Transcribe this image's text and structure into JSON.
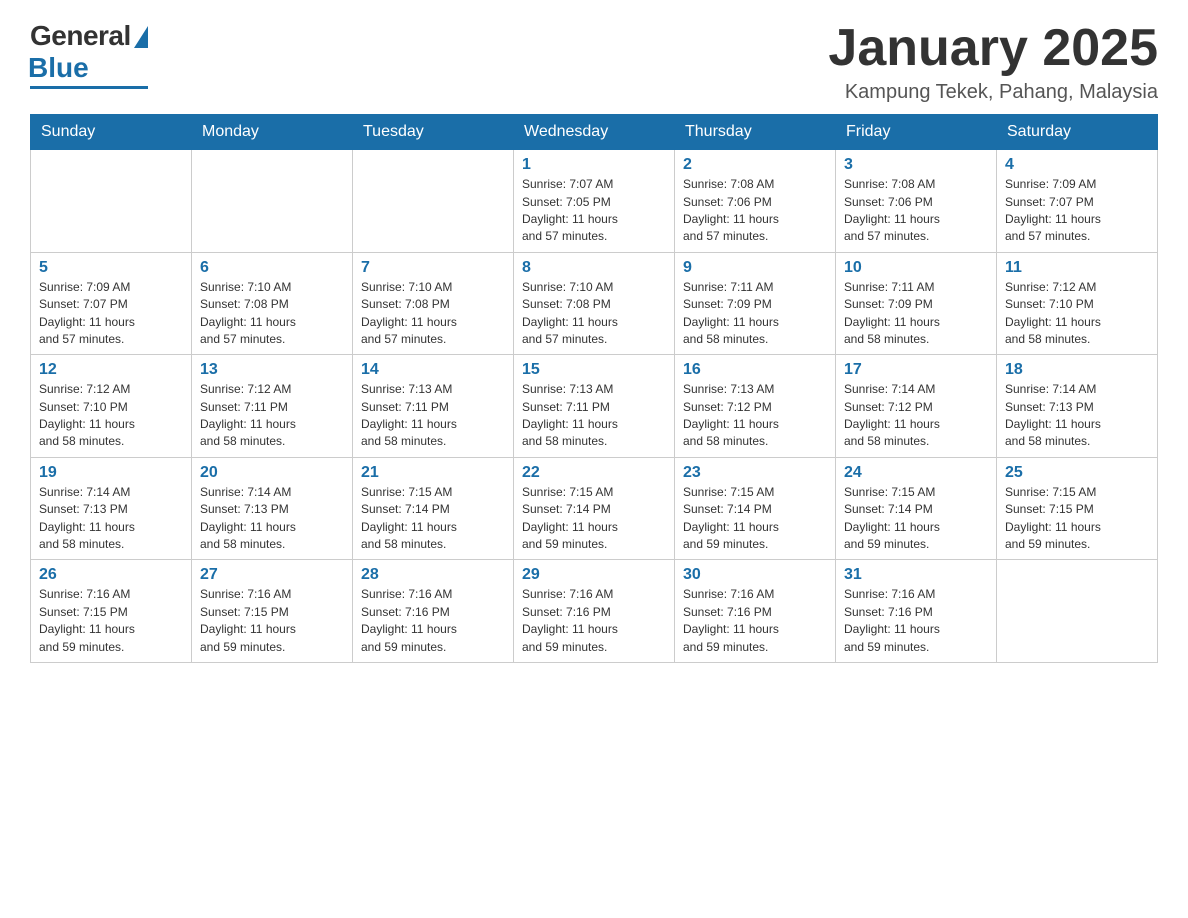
{
  "header": {
    "logo": {
      "general_text": "General",
      "blue_text": "Blue"
    },
    "title": "January 2025",
    "subtitle": "Kampung Tekek, Pahang, Malaysia"
  },
  "days_of_week": [
    "Sunday",
    "Monday",
    "Tuesday",
    "Wednesday",
    "Thursday",
    "Friday",
    "Saturday"
  ],
  "weeks": [
    [
      {
        "day": "",
        "info": ""
      },
      {
        "day": "",
        "info": ""
      },
      {
        "day": "",
        "info": ""
      },
      {
        "day": "1",
        "info": "Sunrise: 7:07 AM\nSunset: 7:05 PM\nDaylight: 11 hours\nand 57 minutes."
      },
      {
        "day": "2",
        "info": "Sunrise: 7:08 AM\nSunset: 7:06 PM\nDaylight: 11 hours\nand 57 minutes."
      },
      {
        "day": "3",
        "info": "Sunrise: 7:08 AM\nSunset: 7:06 PM\nDaylight: 11 hours\nand 57 minutes."
      },
      {
        "day": "4",
        "info": "Sunrise: 7:09 AM\nSunset: 7:07 PM\nDaylight: 11 hours\nand 57 minutes."
      }
    ],
    [
      {
        "day": "5",
        "info": "Sunrise: 7:09 AM\nSunset: 7:07 PM\nDaylight: 11 hours\nand 57 minutes."
      },
      {
        "day": "6",
        "info": "Sunrise: 7:10 AM\nSunset: 7:08 PM\nDaylight: 11 hours\nand 57 minutes."
      },
      {
        "day": "7",
        "info": "Sunrise: 7:10 AM\nSunset: 7:08 PM\nDaylight: 11 hours\nand 57 minutes."
      },
      {
        "day": "8",
        "info": "Sunrise: 7:10 AM\nSunset: 7:08 PM\nDaylight: 11 hours\nand 57 minutes."
      },
      {
        "day": "9",
        "info": "Sunrise: 7:11 AM\nSunset: 7:09 PM\nDaylight: 11 hours\nand 58 minutes."
      },
      {
        "day": "10",
        "info": "Sunrise: 7:11 AM\nSunset: 7:09 PM\nDaylight: 11 hours\nand 58 minutes."
      },
      {
        "day": "11",
        "info": "Sunrise: 7:12 AM\nSunset: 7:10 PM\nDaylight: 11 hours\nand 58 minutes."
      }
    ],
    [
      {
        "day": "12",
        "info": "Sunrise: 7:12 AM\nSunset: 7:10 PM\nDaylight: 11 hours\nand 58 minutes."
      },
      {
        "day": "13",
        "info": "Sunrise: 7:12 AM\nSunset: 7:11 PM\nDaylight: 11 hours\nand 58 minutes."
      },
      {
        "day": "14",
        "info": "Sunrise: 7:13 AM\nSunset: 7:11 PM\nDaylight: 11 hours\nand 58 minutes."
      },
      {
        "day": "15",
        "info": "Sunrise: 7:13 AM\nSunset: 7:11 PM\nDaylight: 11 hours\nand 58 minutes."
      },
      {
        "day": "16",
        "info": "Sunrise: 7:13 AM\nSunset: 7:12 PM\nDaylight: 11 hours\nand 58 minutes."
      },
      {
        "day": "17",
        "info": "Sunrise: 7:14 AM\nSunset: 7:12 PM\nDaylight: 11 hours\nand 58 minutes."
      },
      {
        "day": "18",
        "info": "Sunrise: 7:14 AM\nSunset: 7:13 PM\nDaylight: 11 hours\nand 58 minutes."
      }
    ],
    [
      {
        "day": "19",
        "info": "Sunrise: 7:14 AM\nSunset: 7:13 PM\nDaylight: 11 hours\nand 58 minutes."
      },
      {
        "day": "20",
        "info": "Sunrise: 7:14 AM\nSunset: 7:13 PM\nDaylight: 11 hours\nand 58 minutes."
      },
      {
        "day": "21",
        "info": "Sunrise: 7:15 AM\nSunset: 7:14 PM\nDaylight: 11 hours\nand 58 minutes."
      },
      {
        "day": "22",
        "info": "Sunrise: 7:15 AM\nSunset: 7:14 PM\nDaylight: 11 hours\nand 59 minutes."
      },
      {
        "day": "23",
        "info": "Sunrise: 7:15 AM\nSunset: 7:14 PM\nDaylight: 11 hours\nand 59 minutes."
      },
      {
        "day": "24",
        "info": "Sunrise: 7:15 AM\nSunset: 7:14 PM\nDaylight: 11 hours\nand 59 minutes."
      },
      {
        "day": "25",
        "info": "Sunrise: 7:15 AM\nSunset: 7:15 PM\nDaylight: 11 hours\nand 59 minutes."
      }
    ],
    [
      {
        "day": "26",
        "info": "Sunrise: 7:16 AM\nSunset: 7:15 PM\nDaylight: 11 hours\nand 59 minutes."
      },
      {
        "day": "27",
        "info": "Sunrise: 7:16 AM\nSunset: 7:15 PM\nDaylight: 11 hours\nand 59 minutes."
      },
      {
        "day": "28",
        "info": "Sunrise: 7:16 AM\nSunset: 7:16 PM\nDaylight: 11 hours\nand 59 minutes."
      },
      {
        "day": "29",
        "info": "Sunrise: 7:16 AM\nSunset: 7:16 PM\nDaylight: 11 hours\nand 59 minutes."
      },
      {
        "day": "30",
        "info": "Sunrise: 7:16 AM\nSunset: 7:16 PM\nDaylight: 11 hours\nand 59 minutes."
      },
      {
        "day": "31",
        "info": "Sunrise: 7:16 AM\nSunset: 7:16 PM\nDaylight: 11 hours\nand 59 minutes."
      },
      {
        "day": "",
        "info": ""
      }
    ]
  ]
}
